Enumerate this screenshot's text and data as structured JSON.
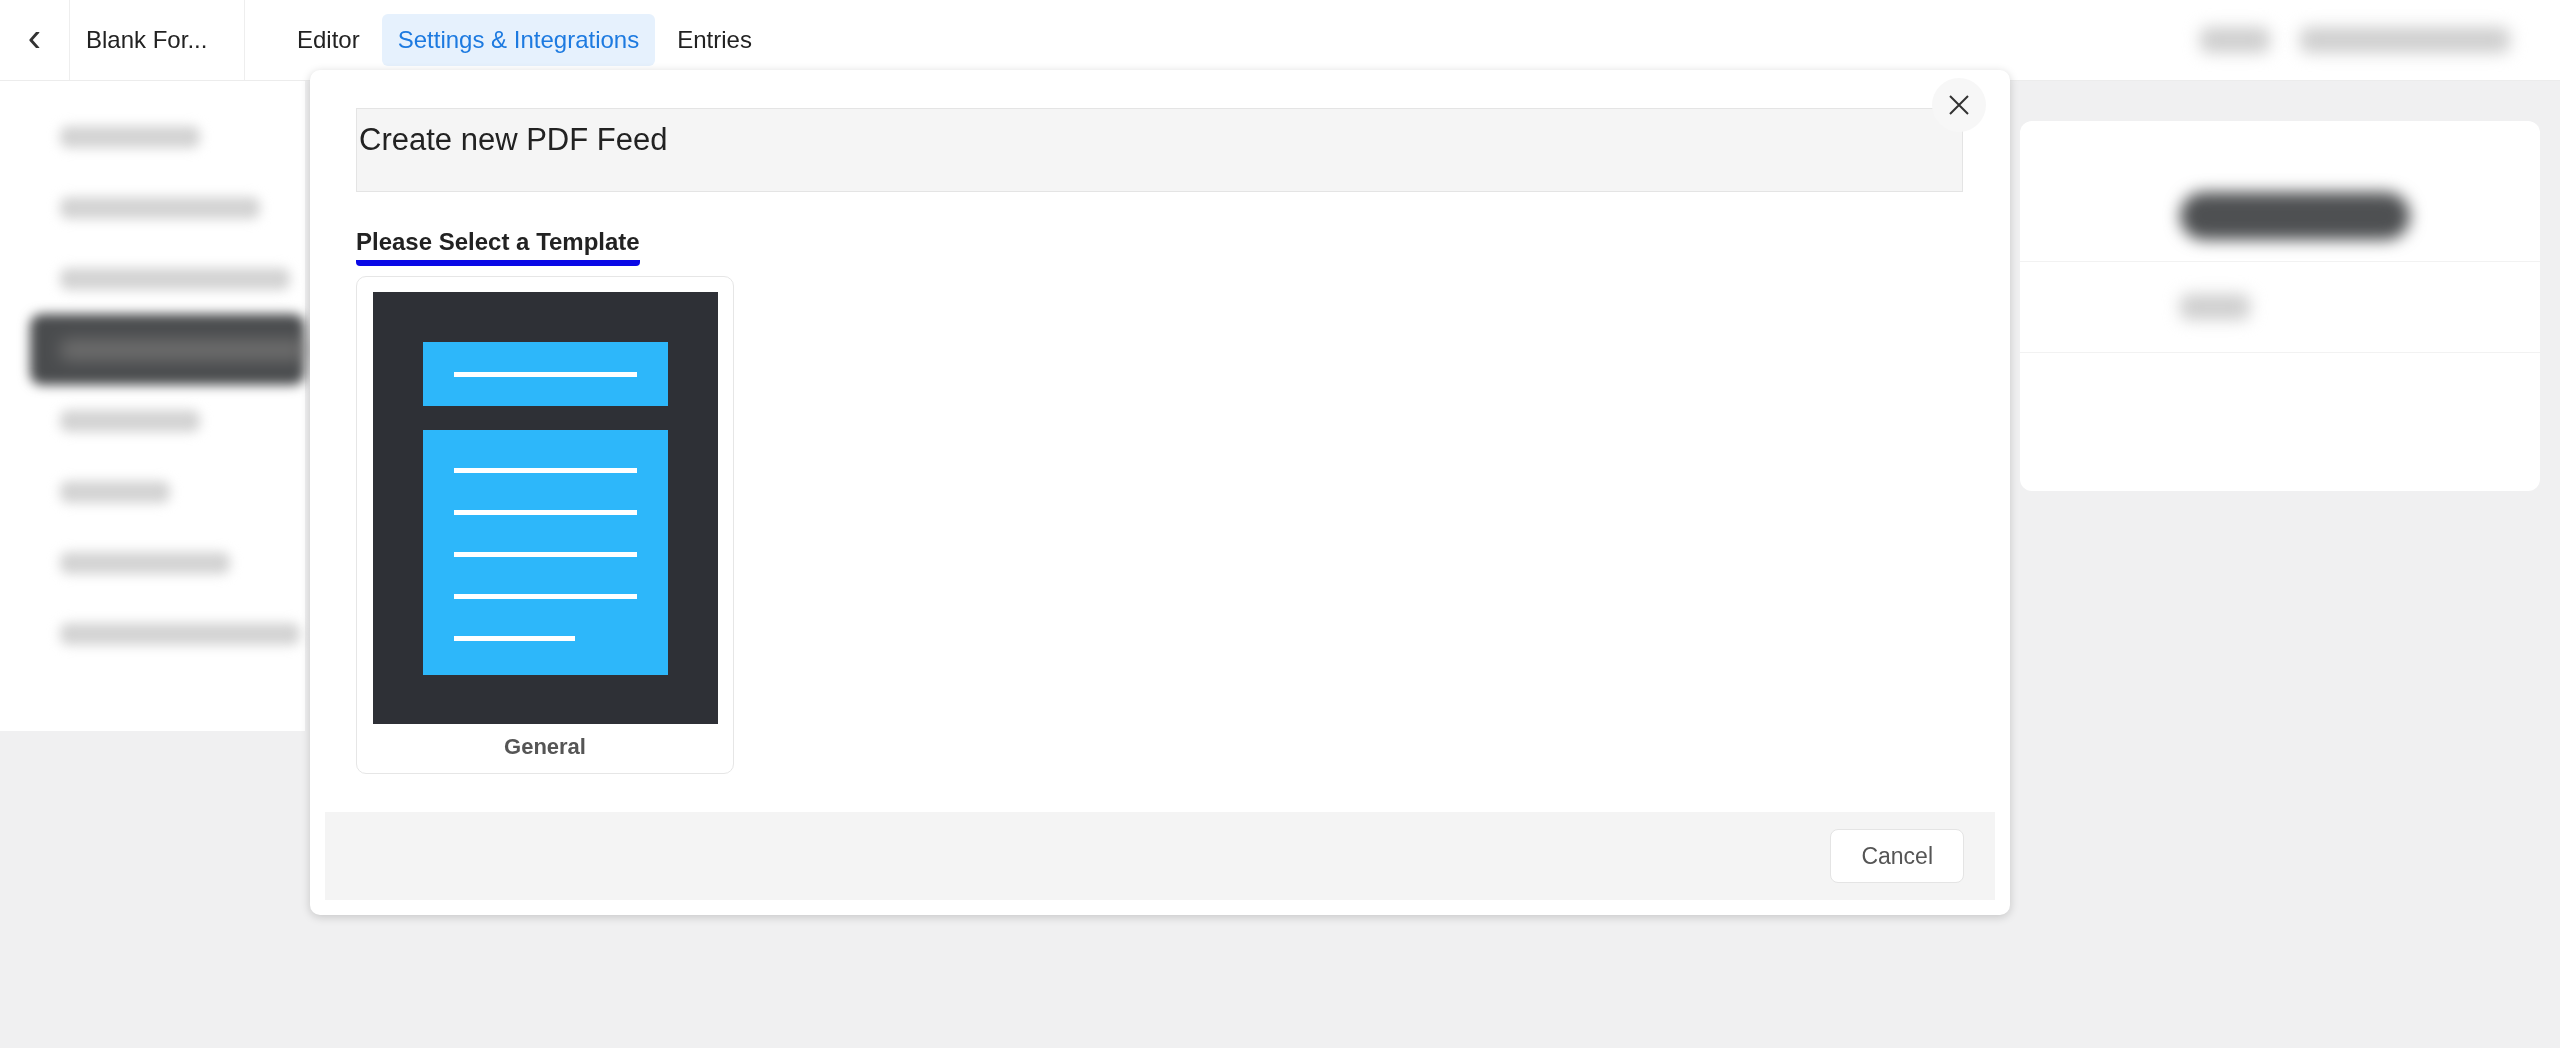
{
  "topbar": {
    "back_icon": "‹",
    "form_title": "Blank For...",
    "tabs": [
      {
        "label": "Editor",
        "selected": false
      },
      {
        "label": "Settings & Integrations",
        "selected": true
      },
      {
        "label": "Entries",
        "selected": false
      }
    ]
  },
  "sidebar": {
    "items": [
      {
        "selected": false
      },
      {
        "selected": false
      },
      {
        "selected": false
      },
      {
        "selected": true
      },
      {
        "selected": false
      },
      {
        "selected": false
      },
      {
        "selected": false
      },
      {
        "selected": false
      }
    ]
  },
  "modal": {
    "title_value": "Create new PDF Feed",
    "section_heading": "Please Select a Template",
    "templates": [
      {
        "name": "General",
        "selected": false
      }
    ],
    "buttons": [
      {
        "label": "Cancel"
      }
    ]
  }
}
